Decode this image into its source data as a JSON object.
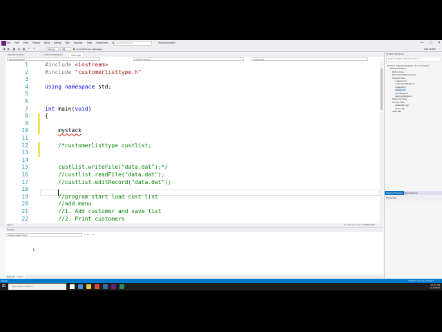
{
  "window": {
    "title": "StackQueueDef",
    "search_placeholder": "Search (Ctrl+Q)",
    "minimize": "—",
    "maximize": "☐",
    "close": "✕",
    "live_share": "Live Share"
  },
  "menu": [
    "File",
    "Edit",
    "View",
    "Project",
    "Build",
    "Debug",
    "Test",
    "Analyze",
    "Tools",
    "Extensions",
    "Window",
    "Help"
  ],
  "toolbar": {
    "config": "Debug",
    "platform": "x86",
    "run_label": "Local Windows Debugger"
  },
  "tabs": [
    {
      "label": "StackQueueDef",
      "active": false
    },
    {
      "label": "customerlisttype.h",
      "active": false
    },
    {
      "label": "main.cpp",
      "active": true
    }
  ],
  "navbar": {
    "project": "StackQueueDef",
    "scope": "(Global Scope)",
    "function": "main(void)"
  },
  "editor": {
    "lines": [
      {
        "n": "1",
        "text": "#include <iostream>",
        "cls": "pp"
      },
      {
        "n": "2",
        "text": "#include \"customerlisttype.h\"",
        "cls": "pp"
      },
      {
        "n": "3",
        "text": "",
        "cls": ""
      },
      {
        "n": "4",
        "text": "using namespace std;",
        "cls": "plain"
      },
      {
        "n": "5",
        "text": "",
        "cls": ""
      },
      {
        "n": "6",
        "text": "",
        "cls": ""
      },
      {
        "n": "7",
        "text": "int main(void)",
        "cls": "plain"
      },
      {
        "n": "8",
        "text": "{",
        "cls": "plain"
      },
      {
        "n": "9",
        "text": "",
        "cls": ""
      },
      {
        "n": "10",
        "text": "    mystack",
        "cls": "err"
      },
      {
        "n": "11",
        "text": "",
        "cls": ""
      },
      {
        "n": "12",
        "text": "    /*customerlisttype custlist;",
        "cls": "cm"
      },
      {
        "n": "13",
        "text": "",
        "cls": ""
      },
      {
        "n": "14",
        "text": "",
        "cls": ""
      },
      {
        "n": "15",
        "text": "    custlist.writeFile(\"data.dat\");*/",
        "cls": "cm"
      },
      {
        "n": "16",
        "text": "    //custlist.readFile(\"data.dat\");",
        "cls": "cm"
      },
      {
        "n": "17",
        "text": "    //custlist.editRecord(\"data.dat\");",
        "cls": "cm"
      },
      {
        "n": "18",
        "text": "",
        "cls": ""
      },
      {
        "n": "19",
        "text": "    //program start load cust list",
        "cls": "cm"
      },
      {
        "n": "20",
        "text": "    //add menu",
        "cls": "cm"
      },
      {
        "n": "21",
        "text": "    //1. Add customer and save list",
        "cls": "cm"
      },
      {
        "n": "22",
        "text": "    //2. Print customers",
        "cls": "cm"
      }
    ],
    "zoom": "100 %",
    "position": "Ln: 13   Ch: 5   Col: 5   TABS   CRLF"
  },
  "solution_explorer": {
    "title": "Solution Explorer",
    "search_placeholder": "Search Solution Explorer (Ctrl+;)",
    "items": [
      {
        "label": "Solution 'StackQueueDef' (1 of 1 project)",
        "indent": 0
      },
      {
        "label": "StackQueueDef",
        "indent": 1
      },
      {
        "label": "References",
        "indent": 2
      },
      {
        "label": "External Dependencies",
        "indent": 2
      },
      {
        "label": "Header Files",
        "indent": 2
      },
      {
        "label": "customer.h",
        "indent": 3
      },
      {
        "label": "customerlisttype.h",
        "indent": 3
      },
      {
        "label": "linkedlist.h",
        "indent": 3
      },
      {
        "label": "mystack.h",
        "indent": 3
      },
      {
        "label": "queuetype.h",
        "indent": 3
      },
      {
        "label": "stacknodetype.h",
        "indent": 3
      },
      {
        "label": "Resource Files",
        "indent": 2
      },
      {
        "label": "Source Files",
        "indent": 2
      },
      {
        "label": "linkedlist.cpp",
        "indent": 3
      },
      {
        "label": "main.cpp",
        "indent": 3
      },
      {
        "label": "data.dat",
        "indent": 2
      }
    ],
    "tabs": [
      {
        "label": "Solution Explorer",
        "active": true
      },
      {
        "label": "Team Explorer",
        "active": false
      }
    ]
  },
  "properties": {
    "title": "Properties"
  },
  "output": {
    "title": "Output",
    "source_label": "Show output from:",
    "buttons": "▾  ≡  ⇤  ⇥  ✎"
  },
  "bottom_tabs": [
    {
      "label": "Error List",
      "active": false
    },
    {
      "label": "Output",
      "active": true
    }
  ],
  "status": {
    "left": "Ready",
    "right": "↑ Add to Source Control ▾"
  },
  "taskbar": {
    "search": "Type here to search",
    "time": "10:21 AM",
    "date": "1/10/2020",
    "icon_colors": [
      "#ffffff",
      "#4a90d9",
      "#f2c744",
      "#e04a2f",
      "#3a6ea5",
      "#68217a",
      "#2e8b57"
    ]
  }
}
